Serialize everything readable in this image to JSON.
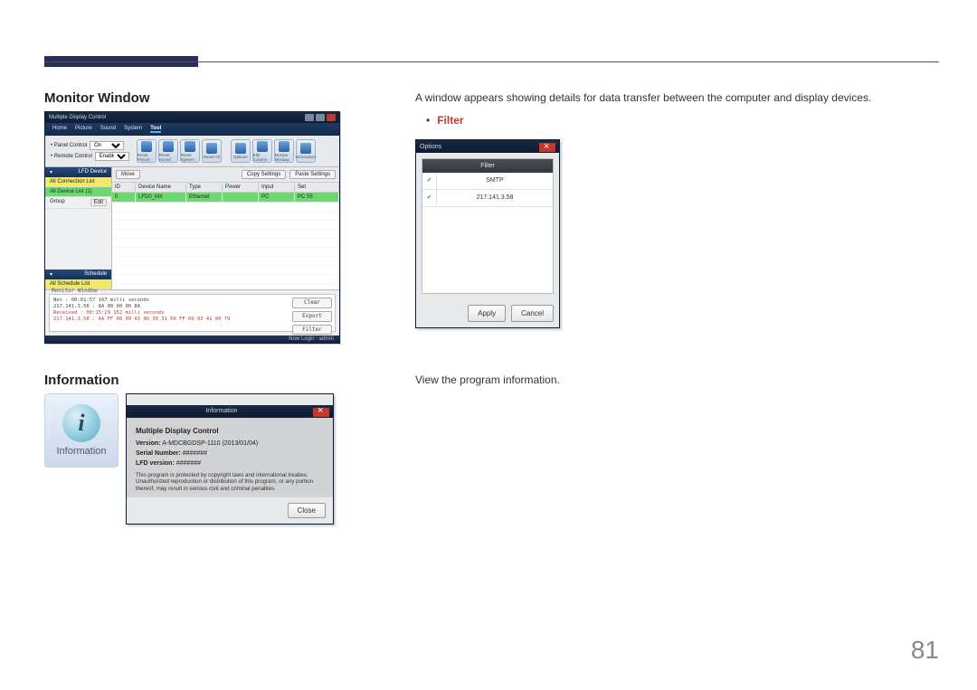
{
  "page_number": "81",
  "sections": {
    "monitor_window": {
      "heading": "Monitor Window",
      "desc": "A window appears showing details for data transfer between the computer and display devices.",
      "filter_bullet": "Filter"
    },
    "information": {
      "heading": "Information",
      "desc": "View the program information."
    }
  },
  "mdc": {
    "title": "Multiple Display Control",
    "menus": [
      "Home",
      "Picture",
      "Sound",
      "System",
      "Tool"
    ],
    "panel_control_label": "• Panel Control",
    "panel_control_value": "On",
    "remote_control_label": "• Remote Control",
    "remote_control_value": "Enable",
    "tool_icons": [
      "Reset Picture",
      "Reset Sound",
      "Reset System",
      "Reset All",
      "Options",
      "Edit Column",
      "Monitor Window",
      "Information"
    ],
    "grid_buttons": [
      "Move",
      "Copy Settings",
      "Paste Settings"
    ],
    "side": {
      "lfd_header": "LFD Device",
      "conn": "All Connection List",
      "device_list": "All Device List (1)",
      "group": "Group",
      "edit": "Edit",
      "schedule_header": "Schedule",
      "schedule_list": "All Schedule List"
    },
    "grid_headers": [
      "ID",
      "Device Name",
      "Type",
      "Power",
      "Input",
      "Set"
    ],
    "grid_row": {
      "id": "0",
      "name": "LFD0_MX",
      "type": "Ethernet",
      "power": "",
      "input": "PC",
      "set": "PC 55"
    },
    "monitor_box": {
      "label": "Monitor Window",
      "line1": "Net : 00:01:57 167 milli seconds",
      "line2": "217.141.3.58 : 8A 00 00 00 8A",
      "line3": "Received : 00:15:29 152 milli seconds",
      "line4": "217.141.3.58 : AA FF 00 09 41 4D 30 31 00 FF 00 03 41 00 79",
      "buttons": [
        "Clear",
        "Export",
        "Filter"
      ]
    },
    "status": "Now Login : admin"
  },
  "options_dialog": {
    "title": "Options",
    "filter_header": "Filter",
    "rows": [
      "SMTP",
      "217.141.3.58"
    ],
    "apply": "Apply",
    "cancel": "Cancel"
  },
  "info_icon_label": "Information",
  "info_dialog": {
    "title": "Information",
    "product": "Multiple Display Control",
    "version_label": "Version:",
    "version": "A-MDCBGDSP-1110 (2013/01/04)",
    "serial_label": "Serial Number:",
    "serial": "#######",
    "lfd_label": "LFD version:",
    "lfd": "#######",
    "legal": "This program is protected by copyright laws and international treaties. Unauthorized reproduction or distribution of this program, or any portion thereof, may result in serious civil and criminal penalties.",
    "close": "Close"
  }
}
